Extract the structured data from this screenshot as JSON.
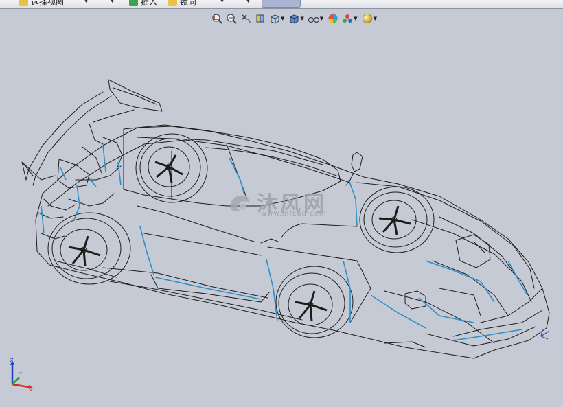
{
  "ribbon": {
    "items": [
      {
        "label": "选择视图",
        "icon_color": "#e8c14a"
      },
      {
        "label": "插入",
        "icon_color": "#3fa34d"
      },
      {
        "label": "镜向",
        "icon_color": "#e8c14a"
      }
    ]
  },
  "view_toolbar": {
    "buttons": [
      {
        "name": "zoom-to-fit-icon"
      },
      {
        "name": "zoom-to-area-icon"
      },
      {
        "name": "previous-view-icon"
      },
      {
        "name": "section-view-icon"
      },
      {
        "name": "view-orientation-icon"
      },
      {
        "name": "display-style-icon"
      },
      {
        "name": "hide-show-items-icon"
      },
      {
        "name": "edit-appearance-icon"
      },
      {
        "name": "apply-scene-icon"
      },
      {
        "name": "view-settings-icon"
      }
    ]
  },
  "watermark": {
    "text": "沐风网",
    "url": "www.mfcad.com"
  },
  "triad": {
    "x_label": "X",
    "y_label": "Y",
    "z_label": "Z"
  },
  "colors": {
    "background": "#c6cad4",
    "wire": "#1c1c1c",
    "edge_highlight": "#2e8fc9"
  }
}
